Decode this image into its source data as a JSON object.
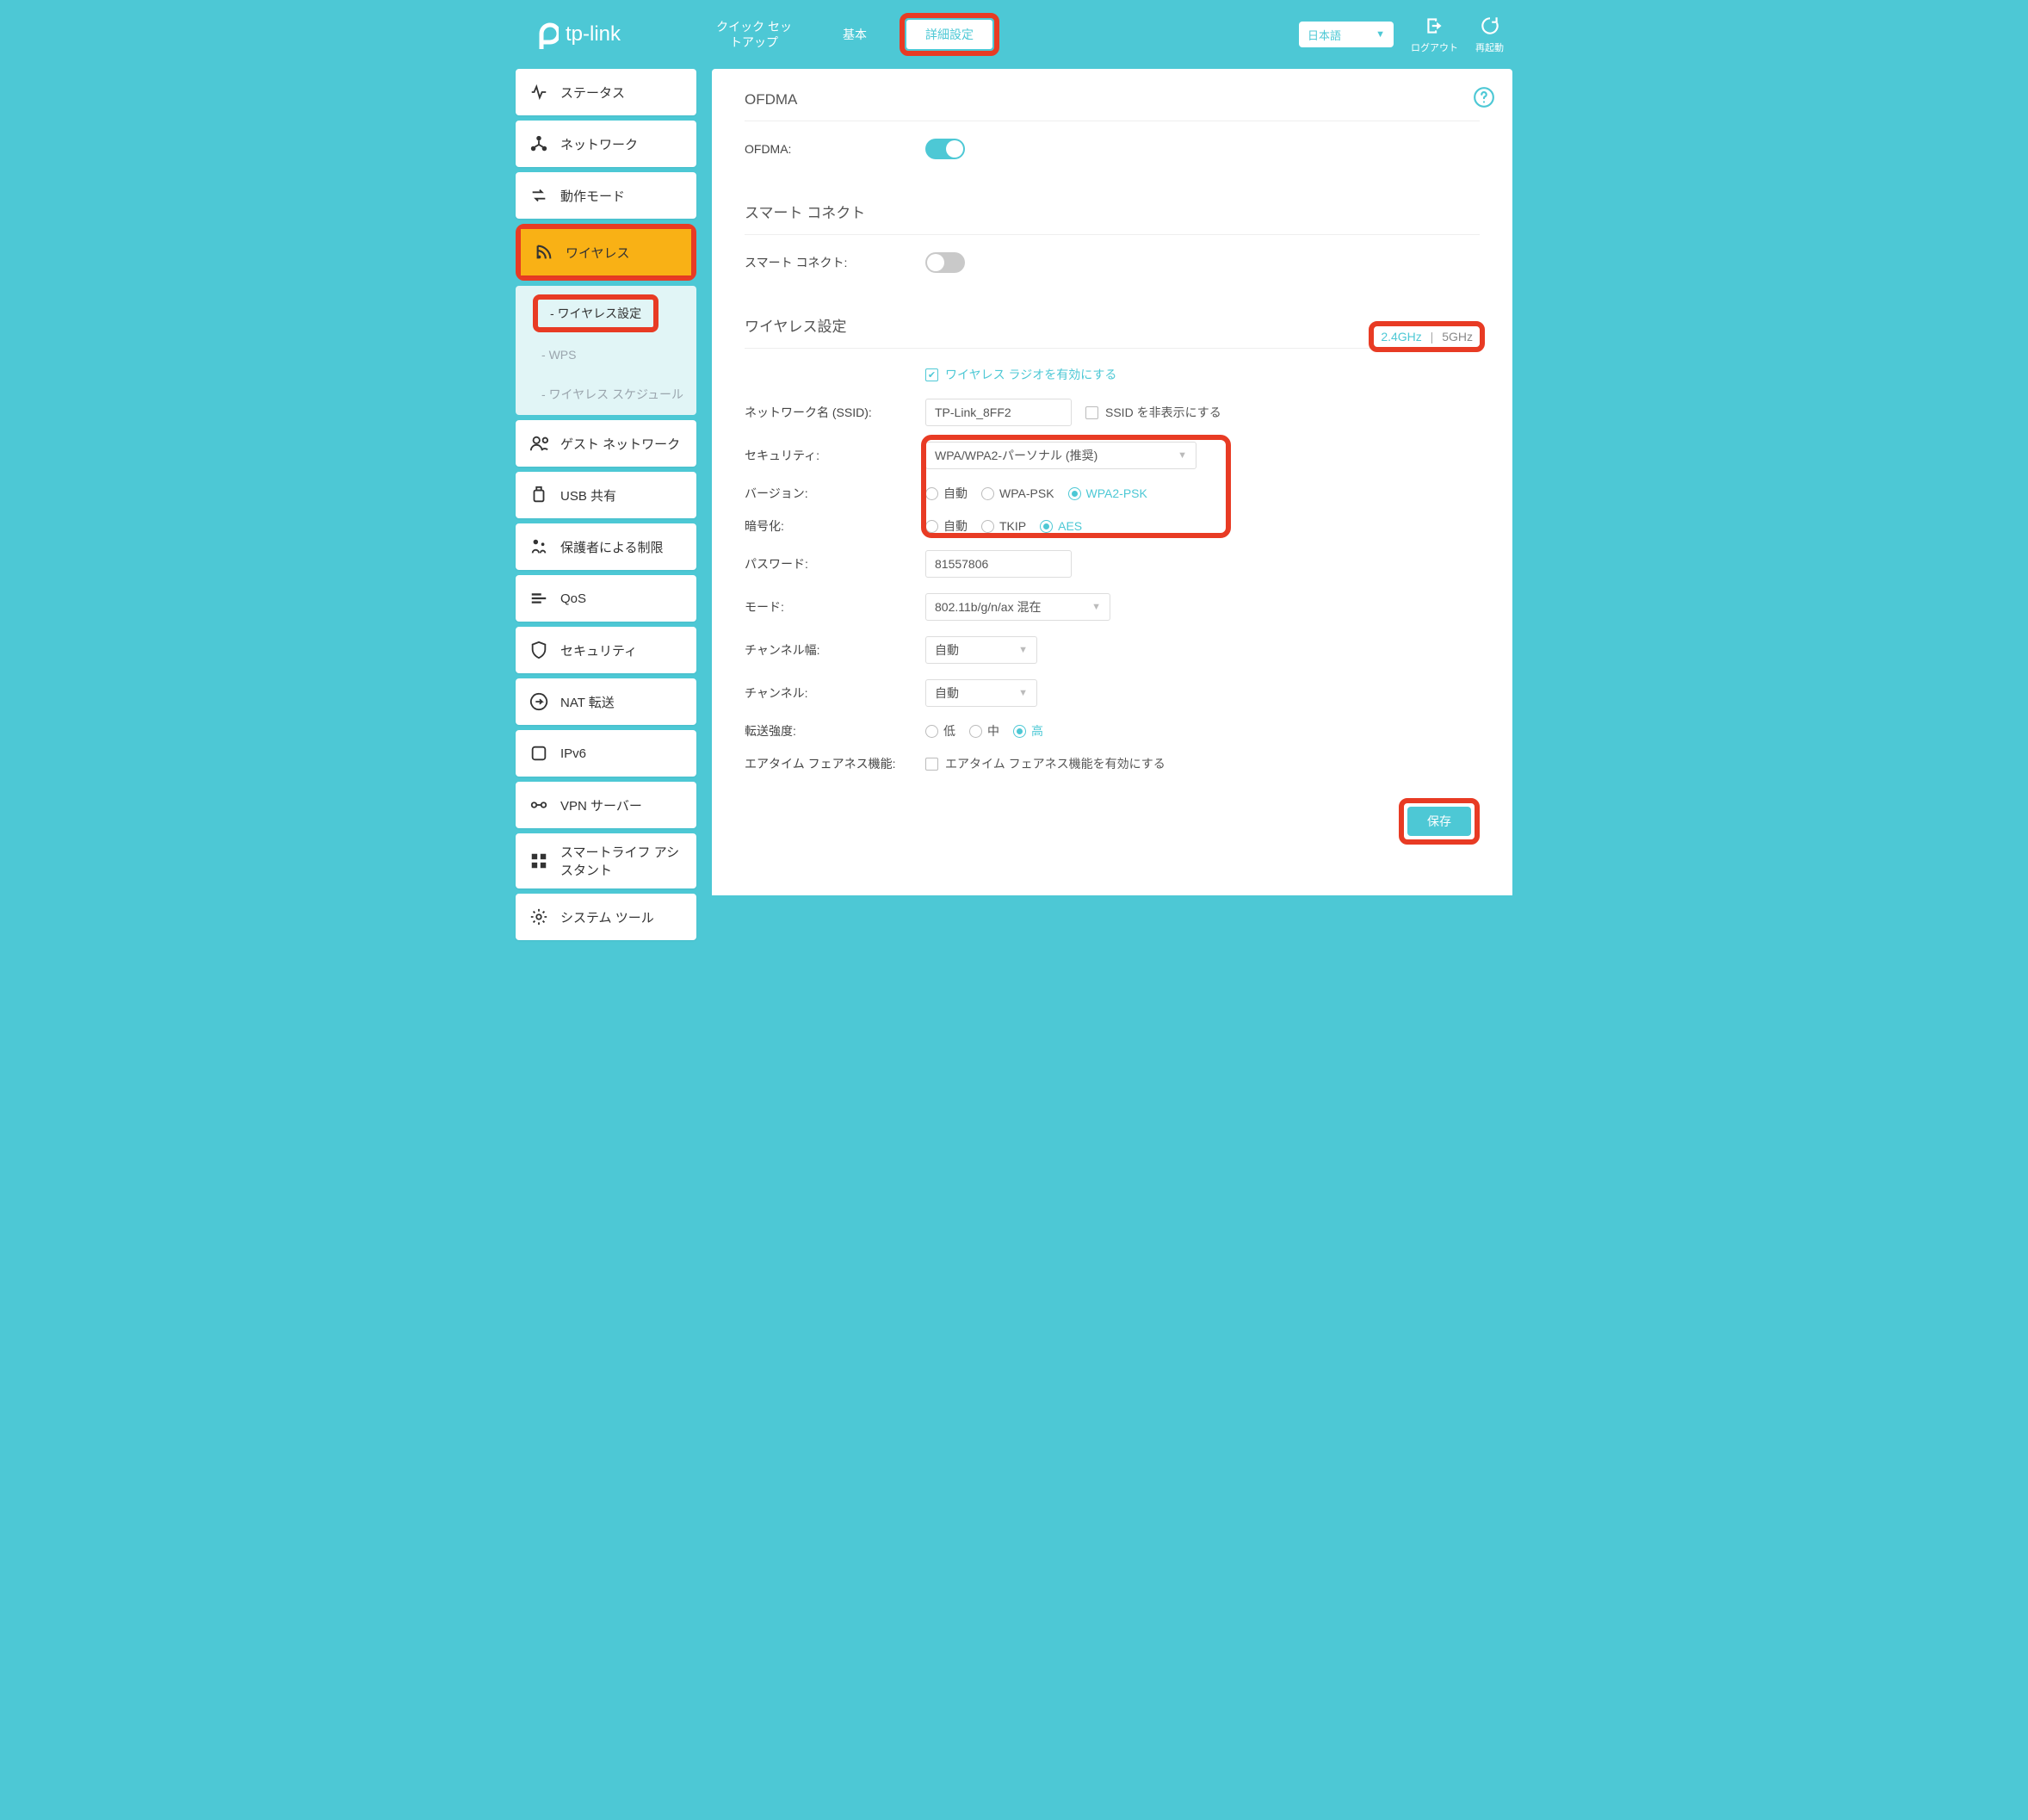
{
  "brand": "tp-link",
  "nav": {
    "quick": "クイック セットアップ",
    "basic": "基本",
    "advanced": "詳細設定"
  },
  "language": "日本語",
  "header_actions": {
    "logout": "ログアウト",
    "reboot": "再起動"
  },
  "sidebar": {
    "items": [
      "ステータス",
      "ネットワーク",
      "動作モード",
      "ワイヤレス",
      "ゲスト ネットワーク",
      "USB 共有",
      "保護者による制限",
      "QoS",
      "セキュリティ",
      "NAT 転送",
      "IPv6",
      "VPN サーバー",
      "スマートライフ アシスタント",
      "システム ツール"
    ],
    "sub": {
      "wireless_settings": "ワイヤレス設定",
      "wps": "WPS",
      "schedule": "ワイヤレス スケジュール"
    }
  },
  "sections": {
    "ofdma_title": "OFDMA",
    "ofdma_label": "OFDMA:",
    "smart_title": "スマート コネクト",
    "smart_label": "スマート コネクト:",
    "wireless_title": "ワイヤレス設定",
    "band_24": "2.4GHz",
    "band_sep": "|",
    "band_5": "5GHz",
    "enable_radio": "ワイヤレス ラジオを有効にする",
    "ssid_label": "ネットワーク名 (SSID):",
    "ssid_value": "TP-Link_8FF2",
    "hide_ssid": "SSID を非表示にする",
    "security_label": "セキュリティ:",
    "security_value": "WPA/WPA2-パーソナル (推奨)",
    "version_label": "バージョン:",
    "v_auto": "自動",
    "v_wpa": "WPA-PSK",
    "v_wpa2": "WPA2-PSK",
    "enc_label": "暗号化:",
    "e_auto": "自動",
    "e_tkip": "TKIP",
    "e_aes": "AES",
    "pwd_label": "パスワード:",
    "pwd_value": "81557806",
    "mode_label": "モード:",
    "mode_value": "802.11b/g/n/ax 混在",
    "chw_label": "チャンネル幅:",
    "chw_value": "自動",
    "ch_label": "チャンネル:",
    "ch_value": "自動",
    "power_label": "転送強度:",
    "p_low": "低",
    "p_mid": "中",
    "p_high": "高",
    "airtime_label": "エアタイム フェアネス機能:",
    "airtime_check": "エアタイム フェアネス機能を有効にする",
    "save": "保存"
  },
  "prefix_dash": "- "
}
